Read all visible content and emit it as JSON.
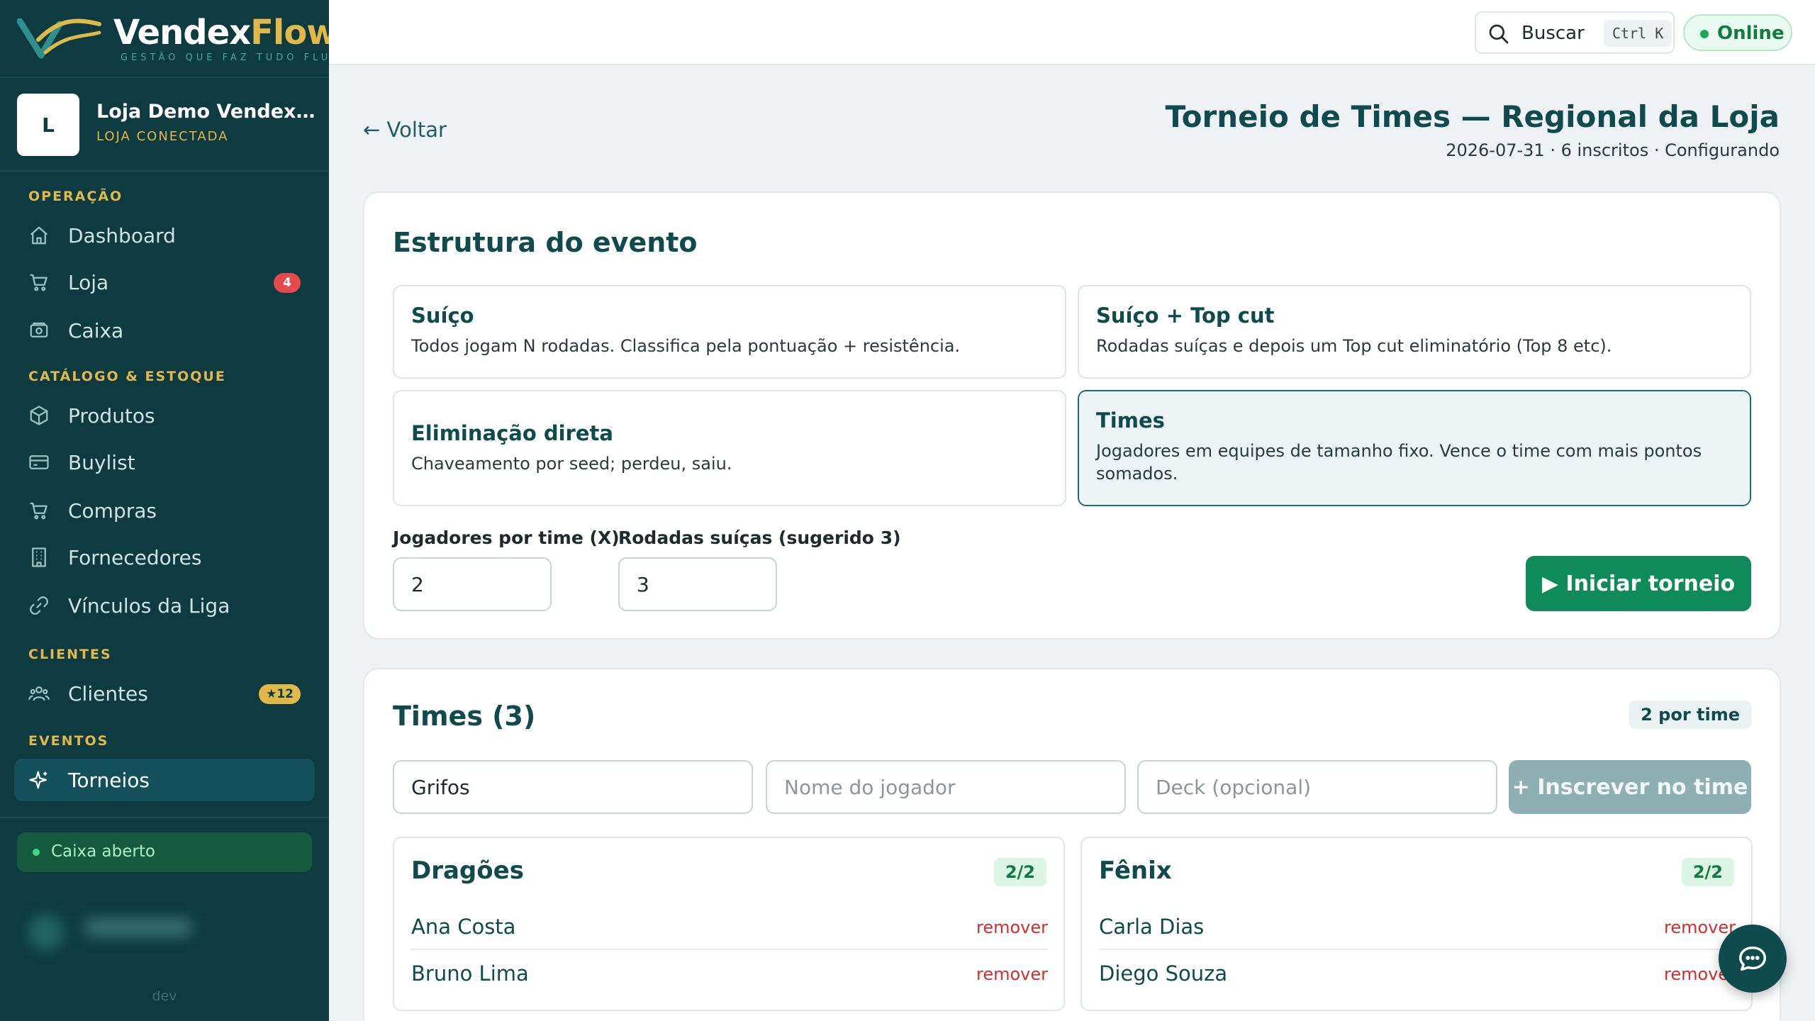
{
  "brand": {
    "name_part1": "Vendex",
    "name_part2": "Flow",
    "tagline": "GESTÃO QUE FAZ TUDO FLUIR"
  },
  "store": {
    "initial": "L",
    "name": "Loja Demo VendexFlow",
    "status": "LOJA CONECTADA"
  },
  "sidebar": {
    "sections": [
      {
        "label": "OPERAÇÃO"
      },
      {
        "label": "CATÁLOGO & ESTOQUE"
      },
      {
        "label": "CLIENTES"
      },
      {
        "label": "EVENTOS"
      }
    ],
    "items": [
      {
        "label": "Dashboard",
        "icon": "home-icon"
      },
      {
        "label": "Loja",
        "icon": "cart-icon",
        "badge": "4"
      },
      {
        "label": "Caixa",
        "icon": "register-icon"
      },
      {
        "label": "Produtos",
        "icon": "box-icon"
      },
      {
        "label": "Buylist",
        "icon": "card-icon"
      },
      {
        "label": "Compras",
        "icon": "cart-icon"
      },
      {
        "label": "Fornecedores",
        "icon": "building-icon"
      },
      {
        "label": "Vínculos da Liga",
        "icon": "link-icon"
      },
      {
        "label": "Clientes",
        "icon": "users-icon",
        "badge": "★12"
      },
      {
        "label": "Torneios",
        "icon": "sparkle-icon",
        "active": true
      }
    ],
    "cash_status": "Caixa aberto",
    "env": "dev"
  },
  "topbar": {
    "search_label": "Buscar",
    "search_shortcut": "Ctrl K",
    "status": "Online"
  },
  "header": {
    "back_label": "← Voltar",
    "title": "Torneio de Times — Regional da Loja",
    "subtitle": "2026-07-31 · 6 inscritos · Configurando"
  },
  "structure": {
    "title": "Estrutura do evento",
    "options": [
      {
        "title": "Suíço",
        "desc": "Todos jogam N rodadas. Classifica pela pontuação + resistência."
      },
      {
        "title": "Suíço + Top cut",
        "desc": "Rodadas suíças e depois um Top cut eliminatório (Top 8 etc)."
      },
      {
        "title": "Eliminação direta",
        "desc": "Chaveamento por seed; perdeu, saiu."
      },
      {
        "title": "Times",
        "desc": "Jogadores em equipes de tamanho fixo. Vence o time com mais pontos somados.",
        "selected": true
      }
    ],
    "players_per_team_label": "Jogadores por time (X)",
    "players_per_team_value": "2",
    "swiss_rounds_label": "Rodadas suíças (sugerido 3)",
    "swiss_rounds_value": "3",
    "start_label": "▶ Iniciar torneio"
  },
  "teams": {
    "title": "Times (3)",
    "per_team_badge": "2 por time",
    "team_input_value": "Grifos",
    "player_placeholder": "Nome do jogador",
    "deck_placeholder": "Deck (opcional)",
    "enroll_label": "+ Inscrever no time",
    "list": [
      {
        "name": "Dragões",
        "count": "2/2",
        "members": [
          {
            "name": "Ana Costa",
            "action": "remover"
          },
          {
            "name": "Bruno Lima",
            "action": "remover"
          }
        ]
      },
      {
        "name": "Fênix",
        "count": "2/2",
        "members": [
          {
            "name": "Carla Dias",
            "action": "remover"
          },
          {
            "name": "Diego Souza",
            "action": "remover"
          }
        ]
      }
    ]
  },
  "colors": {
    "sidebar_bg": "#0d3b40",
    "accent_gold": "#e0b94a",
    "primary_green": "#0e8a5b",
    "danger": "#cf2f2f"
  }
}
